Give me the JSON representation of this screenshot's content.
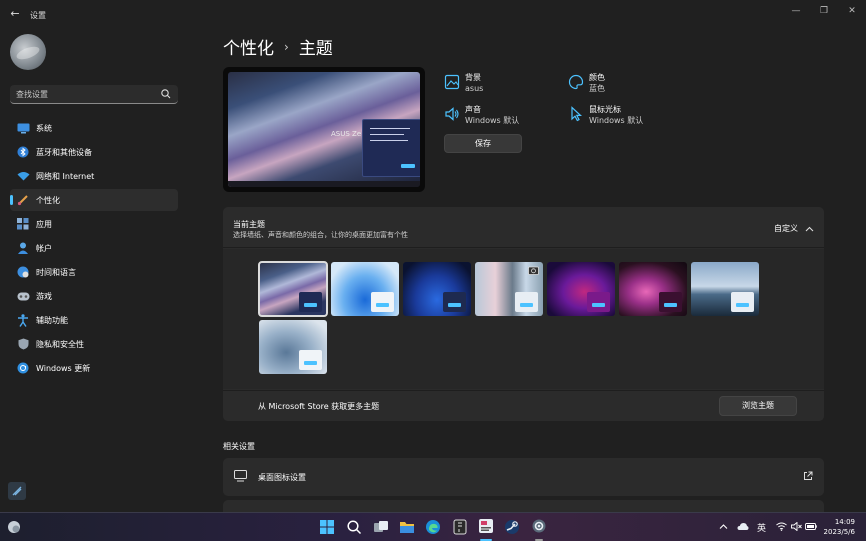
{
  "titlebar": {
    "app_title": "设置",
    "back": "←",
    "minimize": "—",
    "restore": "❐",
    "close": "✕"
  },
  "search": {
    "placeholder": "查找设置"
  },
  "sidebar": {
    "items": [
      {
        "label": "系统",
        "icon": "monitor-icon"
      },
      {
        "label": "蓝牙和其他设备",
        "icon": "bluetooth-icon"
      },
      {
        "label": "网络和 Internet",
        "icon": "wifi-icon"
      },
      {
        "label": "个性化",
        "icon": "brush-icon",
        "active": true
      },
      {
        "label": "应用",
        "icon": "apps-icon"
      },
      {
        "label": "帐户",
        "icon": "account-icon"
      },
      {
        "label": "时间和语言",
        "icon": "globe-clock-icon"
      },
      {
        "label": "游戏",
        "icon": "gamepad-icon"
      },
      {
        "label": "辅助功能",
        "icon": "accessibility-icon"
      },
      {
        "label": "隐私和安全性",
        "icon": "shield-icon"
      },
      {
        "label": "Windows 更新",
        "icon": "update-icon"
      }
    ]
  },
  "breadcrumb": {
    "parent": "个性化",
    "separator": "›",
    "current": "主题"
  },
  "preview": {
    "brand_text": "ASUS Ze"
  },
  "properties": {
    "background": {
      "name": "背景",
      "value": "asus"
    },
    "color": {
      "name": "颜色",
      "value": "蓝色"
    },
    "sound": {
      "name": "声音",
      "value": "Windows 默认"
    },
    "cursor": {
      "name": "鼠标光标",
      "value": "Windows 默认"
    },
    "save_label": "保存"
  },
  "current_theme": {
    "title": "当前主题",
    "subtitle": "选择墙纸、声音和颜色的组合，让你的桌面更加富有个性",
    "value": "自定义",
    "store_text": "从 Microsoft Store 获取更多主题",
    "browse_label": "浏览主题"
  },
  "related": {
    "title": "相关设置",
    "desktop_icons_label": "桌面图标设置"
  },
  "clock": {
    "time": "14:09",
    "date": "2023/5/6"
  },
  "tray": {
    "ime": "英"
  },
  "colors": {
    "accent": "#4cc2ff",
    "background": "#202020",
    "card": "#2b2b2b"
  }
}
